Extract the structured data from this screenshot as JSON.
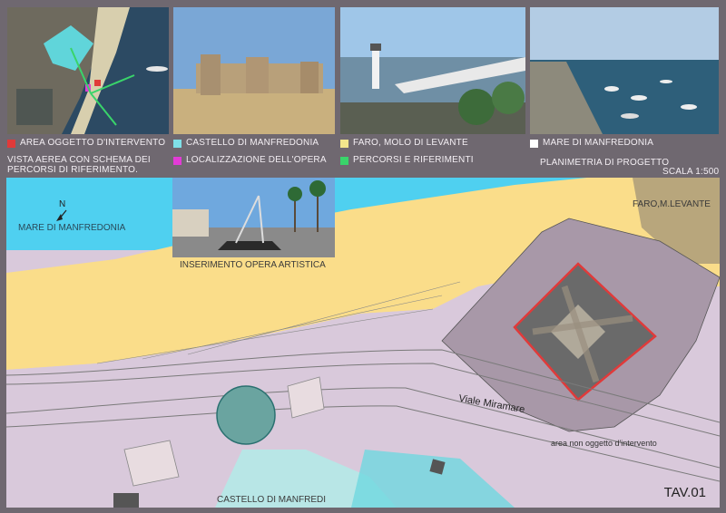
{
  "legend": {
    "area_intervento": {
      "label": "AREA OGGETTO D'INTERVENTO",
      "color": "#e03a3a"
    },
    "castello": {
      "label": "CASTELLO DI MANFREDONIA",
      "color": "#7fe0e8"
    },
    "faro_molo": {
      "label": "FARO, MOLO DI LEVANTE",
      "color": "#f2e58c"
    },
    "mare": {
      "label": "MARE DI MANFREDONIA",
      "color": "#ffffff"
    },
    "localizzazione": {
      "label": "LOCALIZZAZIONE DELL'OPERA",
      "color": "#e23bd6"
    },
    "percorsi": {
      "label": "PERCORSI E RIFERIMENTI",
      "color": "#39d46a"
    },
    "vista_aerea_line1": "VISTA AEREA CON SCHEMA DEI",
    "vista_aerea_line2": "PERCORSI DI RIFERIMENTO.",
    "planimetria": "PLANIMETRIA DI PROGETTO",
    "scala": "SCALA 1:500"
  },
  "map_labels": {
    "north": "N",
    "mare": "MARE DI MANFREDONIA",
    "inserimento": "INSERIMENTO OPERA ARTISTICA",
    "faro": "FARO,M.LEVANTE",
    "viale": "Viale Miramare",
    "area_non": "area non oggetto d'intervento",
    "castello": "CASTELLO DI MANFREDI",
    "tav": "TAV.01"
  },
  "colors": {
    "sea": "#4fd0f0",
    "sand": "#fadd8a",
    "ground": "#d9c9db",
    "project_area": "#a898a8",
    "castle": "#b8e6e6"
  }
}
